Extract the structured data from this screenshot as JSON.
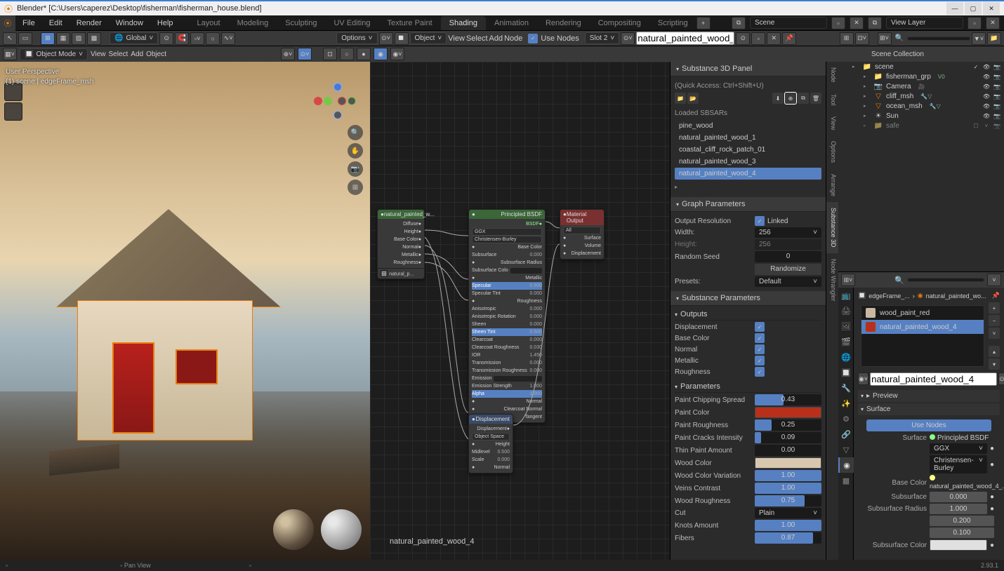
{
  "window": {
    "title": "Blender* [C:\\Users\\caperez\\Desktop\\fisherman\\fisherman_house.blend]"
  },
  "menu": {
    "items": [
      "File",
      "Edit",
      "Render",
      "Window",
      "Help"
    ]
  },
  "workspace_tabs": [
    "Layout",
    "Modeling",
    "Sculpting",
    "UV Editing",
    "Texture Paint",
    "Shading",
    "Animation",
    "Rendering",
    "Compositing",
    "Scripting"
  ],
  "workspace_active": "Shading",
  "scene_field": "Scene",
  "layer_field": "View Layer",
  "toolbar": {
    "global": "Global",
    "options": "Options"
  },
  "viewport_header": {
    "mode": "Object Mode",
    "menu": [
      "View",
      "Select",
      "Add",
      "Object"
    ]
  },
  "viewport_info": {
    "l1": "User Perspective",
    "l2": "(1) scene | edgeFrame_msh"
  },
  "node_header": {
    "object": "Object",
    "menu": [
      "View",
      "Select",
      "Add",
      "Node"
    ],
    "use_nodes": "Use Nodes",
    "slot": "Slot 2",
    "material": "natural_painted_wood_4"
  },
  "side_tabs": [
    "Node",
    "Tool",
    "View",
    "Options",
    "Arrange",
    "Substance 3D",
    "Node Wrangler"
  ],
  "substance": {
    "panel_title": "Substance 3D Panel",
    "quick_access": "(Quick Access: Ctrl+Shift+U)",
    "loaded_label": "Loaded SBSARs",
    "loaded": [
      "pine_wood",
      "natural_painted_wood_1",
      "coastal_cliff_rock_patch_01",
      "natural_painted_wood_3",
      "natural_painted_wood_4"
    ],
    "graph_params": {
      "title": "Graph Parameters",
      "out_res": "Output Resolution",
      "linked": "Linked",
      "width_lbl": "Width:",
      "height_lbl": "Height:",
      "width": "256",
      "height": "256",
      "seed_lbl": "Random Seed",
      "seed": "0",
      "randomize": "Randomize",
      "presets_lbl": "Presets:",
      "preset": "Default"
    },
    "sub_params": {
      "title": "Substance Parameters",
      "outputs_title": "Outputs",
      "outputs": [
        "Displacement",
        "Base Color",
        "Normal",
        "Metallic",
        "Roughness"
      ],
      "params_title": "Parameters",
      "params": [
        {
          "n": "Paint Chipping Spread",
          "v": "0.43",
          "f": 0.43
        },
        {
          "n": "Paint Color",
          "color": "#b8301c"
        },
        {
          "n": "Paint Roughness",
          "v": "0.25",
          "f": 0.25
        },
        {
          "n": "Paint Cracks Intensity",
          "v": "0.09",
          "f": 0.09
        },
        {
          "n": "Thin Paint Amount",
          "v": "0.00",
          "f": 0.0
        },
        {
          "n": "Wood Color",
          "color": "#d8c8b0"
        },
        {
          "n": "Wood Color Variation",
          "v": "1.00",
          "f": 1.0
        },
        {
          "n": "Veins Contrast",
          "v": "1.00",
          "f": 1.0
        },
        {
          "n": "Wood Roughness",
          "v": "0.75",
          "f": 0.75
        },
        {
          "n": "Cut",
          "dropdown": "Plain"
        },
        {
          "n": "Knots Amount",
          "v": "1.00",
          "f": 1.0
        },
        {
          "n": "Fibers",
          "v": "0.87",
          "f": 0.87
        }
      ]
    }
  },
  "outliner": {
    "title": "Scene Collection",
    "items": [
      {
        "l": 1,
        "icon": "📁",
        "name": "scene",
        "badges": [
          "✓",
          "👁",
          "📷"
        ]
      },
      {
        "l": 2,
        "icon": "📁",
        "name": "fisherman_grp",
        "ext": "V0",
        "badges": [
          "👁",
          "📷"
        ]
      },
      {
        "l": 2,
        "icon": "📷",
        "iconcls": "cam-icon",
        "name": "Camera",
        "ext": "🎥",
        "badges": [
          "👁",
          "📷"
        ]
      },
      {
        "l": 2,
        "icon": "▽",
        "iconcls": "mesh-icon",
        "name": "cliff_msh",
        "ext": "🔧▽",
        "badges": [
          "👁",
          "📷"
        ]
      },
      {
        "l": 2,
        "icon": "▽",
        "iconcls": "mesh-icon",
        "name": "ocean_msh",
        "ext": "🔧▽",
        "badges": [
          "👁",
          "📷"
        ]
      },
      {
        "l": 2,
        "icon": "☀",
        "name": "Sun",
        "badges": [
          "👁",
          "📷"
        ]
      },
      {
        "l": 2,
        "icon": "📁",
        "name": "safe",
        "dim": true,
        "badges": [
          "☐",
          "˅",
          "📷"
        ]
      }
    ]
  },
  "properties": {
    "breadcrumb1": "edgeFrame_...",
    "breadcrumb2": "natural_painted_wo...",
    "materials": [
      "wood_paint_red",
      "natural_painted_wood_4"
    ],
    "material_field": "natural_painted_wood_4",
    "preview": "Preview",
    "surface": "Surface",
    "use_nodes": "Use Nodes",
    "surface_lbl": "Surface",
    "bsdf": "Principled BSDF",
    "dist": "GGX",
    "subsurf_method": "Christensen-Burley",
    "base_color_lbl": "Base Color",
    "base_color_val": "natural_painted_wood_4_...",
    "subsurface_lbl": "Subsurface",
    "subsurface": "0.000",
    "subsurface_rad_lbl": "Subsurface Radius",
    "subsurface_rad": [
      "1.000",
      "0.200",
      "0.100"
    ],
    "subsurface_col_lbl": "Subsurface Color"
  },
  "nodes": {
    "tex": {
      "title": "natural_painted_w...",
      "rows": [
        "Diffuse",
        "Height",
        "Base Color",
        "Normal",
        "Metallic",
        "Roughness"
      ],
      "img": "natural_p..."
    },
    "bsdf": {
      "title": "Principled BSDF",
      "out": "BSDF",
      "dist": "GGX",
      "subsurf": "Christensen-Burley",
      "rows": [
        {
          "n": "Base Color",
          "link": true
        },
        {
          "n": "Subsurface",
          "v": "0.000"
        },
        {
          "n": "Subsurface Radius",
          "link": true
        },
        {
          "n": "Subsurface Colo",
          "bar": true
        },
        {
          "n": "Metallic",
          "link": true
        },
        {
          "n": "Specular",
          "v": "0.500",
          "sel": true
        },
        {
          "n": "Specular Tint",
          "v": "0.000"
        },
        {
          "n": "Roughness",
          "link": true
        },
        {
          "n": "Anisotropic",
          "v": "0.000"
        },
        {
          "n": "Anisotropic Rotation",
          "v": "0.000"
        },
        {
          "n": "Sheen",
          "v": "0.000"
        },
        {
          "n": "Sheen Tint",
          "v": "0.500",
          "sel": true
        },
        {
          "n": "Clearcoat",
          "v": "0.000"
        },
        {
          "n": "Clearcoat Roughness",
          "v": "0.030"
        },
        {
          "n": "IOR",
          "v": "1.450"
        },
        {
          "n": "Transmission",
          "v": "0.000"
        },
        {
          "n": "Transmission Roughness",
          "v": "0.000"
        },
        {
          "n": "Emission",
          "bar": true
        },
        {
          "n": "Emission Strength",
          "v": "1.000"
        },
        {
          "n": "Alpha",
          "v": "1.000",
          "sel": true
        },
        {
          "n": "Normal",
          "link": true
        },
        {
          "n": "Clearcoat Normal",
          "link": true
        },
        {
          "n": "Tangent",
          "link": true
        }
      ]
    },
    "output": {
      "title": "Material Output",
      "all": "All",
      "rows": [
        "Surface",
        "Volume",
        "Displacement"
      ]
    },
    "disp": {
      "title": "Displacement",
      "out": "Displacement",
      "space": "Object Space",
      "rows": [
        {
          "n": "Height",
          "link": true
        },
        {
          "n": "Midlevel",
          "v": "0.500"
        },
        {
          "n": "Scale",
          "v": "0.000"
        },
        {
          "n": "Normal",
          "link": true
        }
      ]
    }
  },
  "node_label": "natural_painted_wood_4",
  "status": {
    "l1": "Pan View",
    "version": "2.93.1"
  }
}
